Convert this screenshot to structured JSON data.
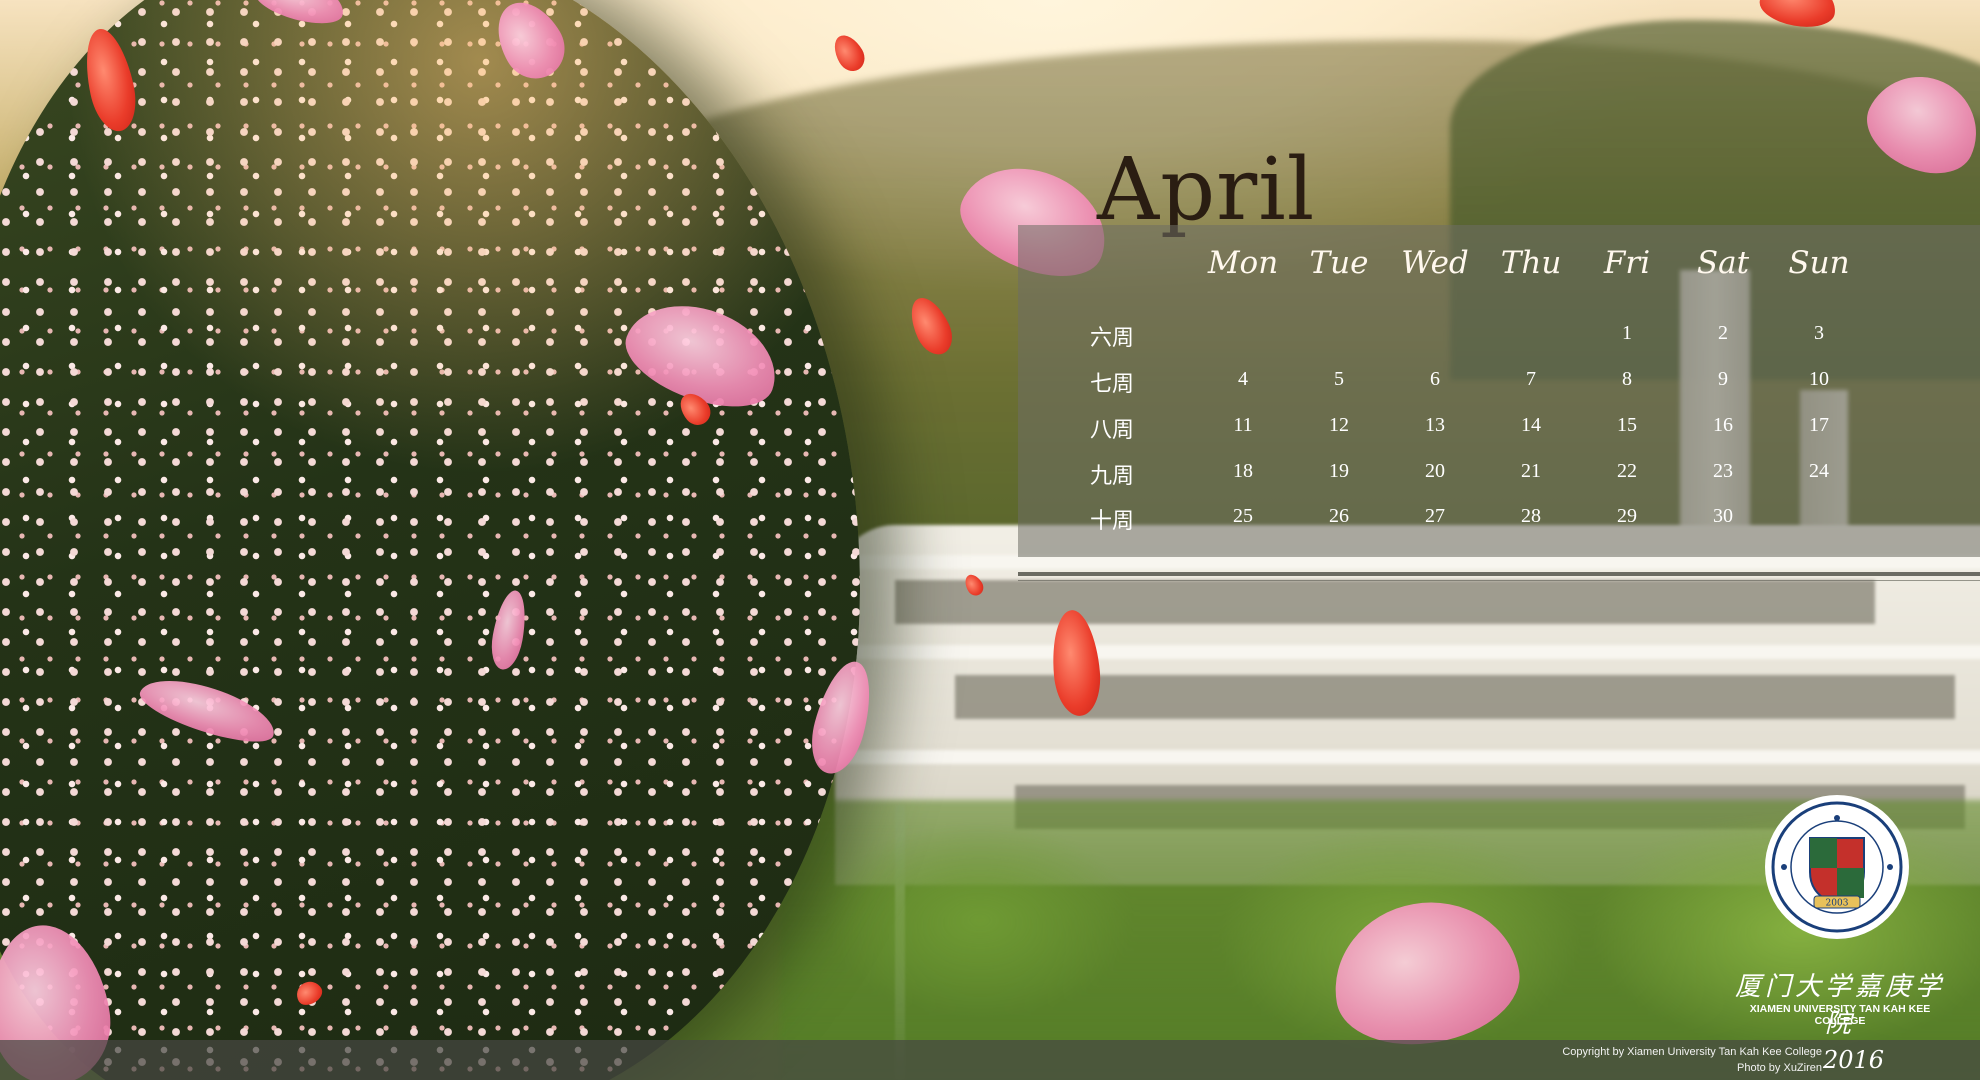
{
  "calendar": {
    "month": "April",
    "day_headers": [
      "Mon",
      "Tue",
      "Wed",
      "Thu",
      "Fri",
      "Sat",
      "Sun"
    ],
    "weeks": [
      {
        "label": "六周",
        "days": [
          "",
          "",
          "",
          "",
          "1",
          "2",
          "3"
        ]
      },
      {
        "label": "七周",
        "days": [
          "4",
          "5",
          "6",
          "7",
          "8",
          "9",
          "10"
        ]
      },
      {
        "label": "八周",
        "days": [
          "11",
          "12",
          "13",
          "14",
          "15",
          "16",
          "17"
        ]
      },
      {
        "label": "九周",
        "days": [
          "18",
          "19",
          "20",
          "21",
          "22",
          "23",
          "24"
        ]
      },
      {
        "label": "十周",
        "days": [
          "25",
          "26",
          "27",
          "28",
          "29",
          "30",
          ""
        ]
      }
    ]
  },
  "logo": {
    "seal_year": "2003",
    "name_cn": "厦门大学嘉庚学院",
    "name_en": "XIAMEN UNIVERSITY TAN KAH KEE COLLEGE"
  },
  "footer": {
    "copyright": "Copyright by Xiamen University Tan Kah Kee College",
    "photo_credit": "Photo by XuZiren",
    "year": "2016"
  },
  "colors": {
    "petal_pink": "#f38fb8",
    "petal_red": "#ea3c2a",
    "panel": "#6e6e64"
  }
}
